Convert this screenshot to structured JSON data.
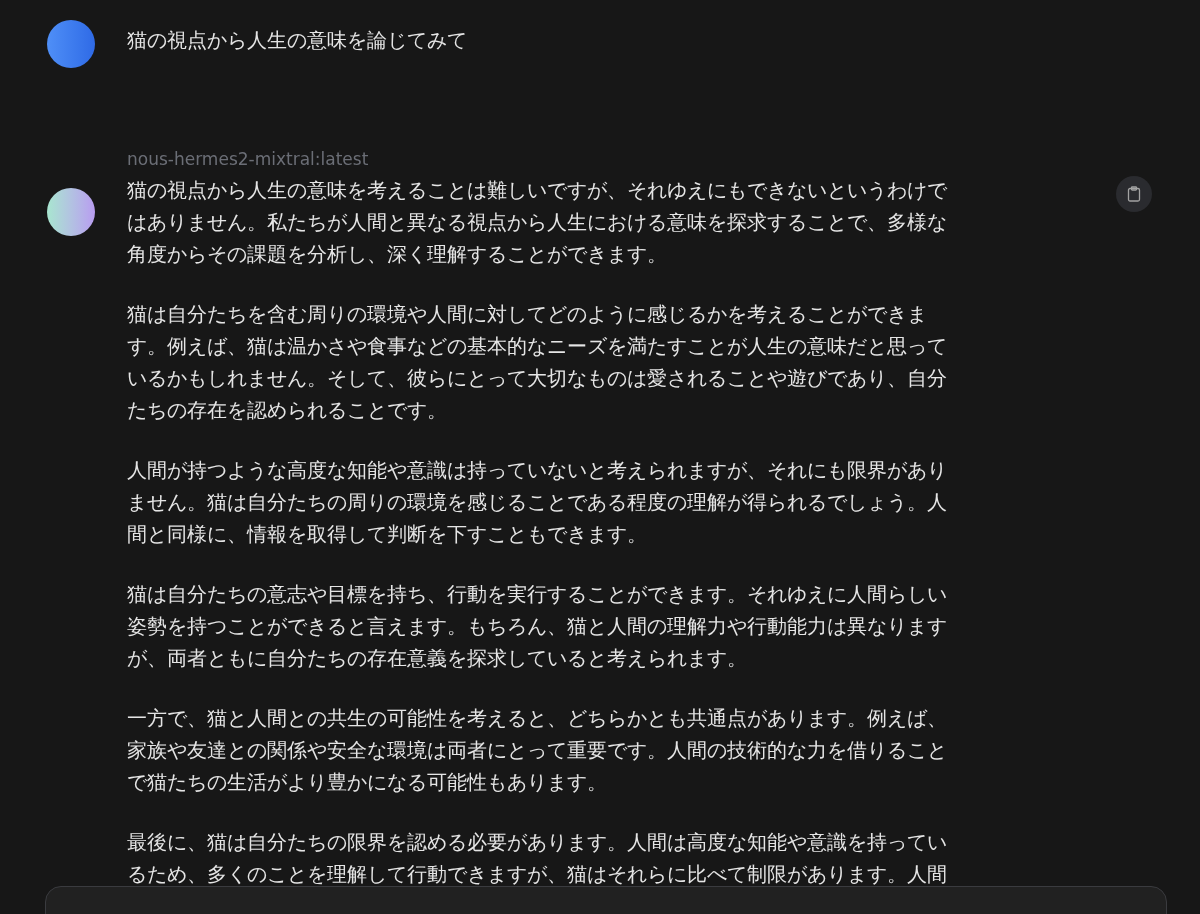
{
  "messages": [
    {
      "kind": "user",
      "text": [
        "猫の視点から人生の意味を論じてみて"
      ]
    },
    {
      "kind": "assistant",
      "model": "nous-hermes2-mixtral:latest",
      "text": [
        "猫の視点から人生の意味を考えることは難しいですが、それゆえにもできないというわけではありません。私たちが人間と異なる視点から人生における意味を探求することで、多様な角度からその課題を分析し、深く理解することができます。",
        "猫は自分たちを含む周りの環境や人間に対してどのように感じるかを考えることができます。例えば、猫は温かさや食事などの基本的なニーズを満たすことが人生の意味だと思っているかもしれません。そして、彼らにとって大切なものは愛されることや遊びであり、自分たちの存在を認められることです。",
        "人間が持つような高度な知能や意識は持っていないと考えられますが、それにも限界がありません。猫は自分たちの周りの環境を感じることである程度の理解が得られるでしょう。人間と同様に、情報を取得して判断を下すこともできます。",
        "猫は自分たちの意志や目標を持ち、行動を実行することができます。それゆえに人間らしい姿勢を持つことができると言えます。もちろん、猫と人間の理解力や行動能力は異なりますが、両者ともに自分たちの存在意義を探求していると考えられます。",
        "一方で、猫と人間との共生の可能性を考えると、どちらかとも共通点があります。例えば、家族や友達との関係や安全な環境は両者にとって重要です。人間の技術的な力を借りることで猫たちの生活がより豊かになる可能性もあります。",
        "最後に、猫は自分たちの限界を認める必要があります。人間は高度な知能や意識を持っているため、多くのことを理解して行動できますが、猫はそれらに比べて制限があります。人間"
      ]
    }
  ]
}
